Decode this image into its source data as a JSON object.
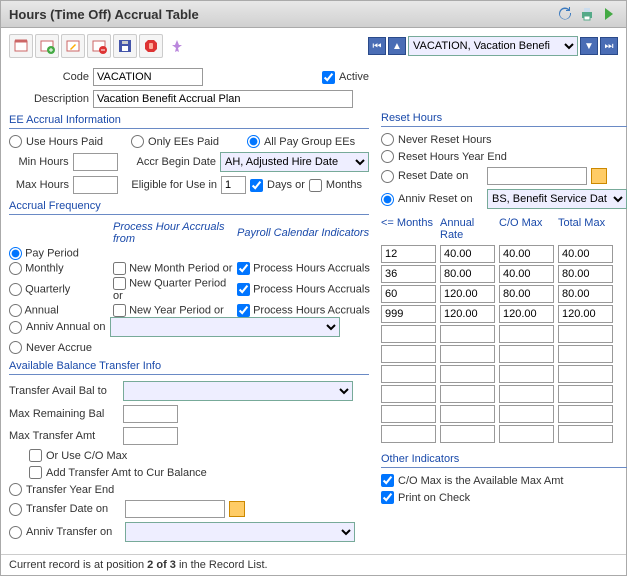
{
  "title": "Hours (Time Off) Accrual Table",
  "recordSelector": "VACATION, Vacation Benefi",
  "form": {
    "codeLabel": "Code",
    "code": "VACATION",
    "activeLabel": "Active",
    "descLabel": "Description",
    "desc": "Vacation Benefit Accrual Plan"
  },
  "eeAccrual": {
    "head": "EE Accrual Information",
    "useHoursPaid": "Use Hours Paid",
    "onlyEEsPaid": "Only EEs Paid",
    "allPayGroup": "All Pay Group EEs",
    "minHoursLabel": "Min Hours",
    "minHours": "",
    "accrBeginDateLabel": "Accr Begin Date",
    "accrBeginDate": "AH, Adjusted Hire Date",
    "maxHoursLabel": "Max Hours",
    "maxHours": "",
    "eligibleLabel": "Eligible for Use in",
    "eligible": "1",
    "daysLabel": "Days or",
    "monthsLabel": "Months"
  },
  "freq": {
    "head": "Accrual Frequency",
    "payPeriod": "Pay Period",
    "monthly": "Monthly",
    "quarterly": "Quarterly",
    "annual": "Annual",
    "annivAnnualOn": "Anniv Annual on",
    "neverAccrue": "Never Accrue",
    "procHead": "Process Hour Accruals from",
    "calHead": "Payroll Calendar Indicators",
    "newMonth": "New Month Period or",
    "newQuarter": "New Quarter Period or",
    "newYear": "New Year Period or",
    "procHours": "Process Hours Accruals"
  },
  "transfer": {
    "head": "Available Balance Transfer Info",
    "transferTo": "Transfer Avail Bal to",
    "maxRemain": "Max Remaining Bal",
    "maxTransfer": "Max Transfer Amt",
    "orUseCo": "Or Use C/O Max",
    "addToBal": "Add Transfer Amt to Cur Balance",
    "yearEnd": "Transfer Year End",
    "dateOn": "Transfer Date on",
    "annivOn": "Anniv Transfer on"
  },
  "reset": {
    "head": "Reset Hours",
    "never": "Never Reset Hours",
    "yearEnd": "Reset Hours Year End",
    "dateOn": "Reset Date on",
    "annivOn": "Anniv Reset on",
    "annivSel": "BS, Benefit Service Dat"
  },
  "tiers": {
    "hMonths": "<= Months",
    "hRate": "Annual Rate",
    "hCoMax": "C/O Max",
    "hTotal": "Total Max",
    "rows": [
      {
        "m": "12",
        "r": "40.00",
        "c": "40.00",
        "t": "40.00"
      },
      {
        "m": "36",
        "r": "80.00",
        "c": "40.00",
        "t": "80.00"
      },
      {
        "m": "60",
        "r": "120.00",
        "c": "80.00",
        "t": "80.00"
      },
      {
        "m": "999",
        "r": "120.00",
        "c": "120.00",
        "t": "120.00"
      },
      {
        "m": "",
        "r": "",
        "c": "",
        "t": ""
      },
      {
        "m": "",
        "r": "",
        "c": "",
        "t": ""
      },
      {
        "m": "",
        "r": "",
        "c": "",
        "t": ""
      },
      {
        "m": "",
        "r": "",
        "c": "",
        "t": ""
      },
      {
        "m": "",
        "r": "",
        "c": "",
        "t": ""
      },
      {
        "m": "",
        "r": "",
        "c": "",
        "t": ""
      }
    ]
  },
  "other": {
    "head": "Other Indicators",
    "coMaxAvail": "C/O Max is the Available Max Amt",
    "printCheck": "Print on Check"
  },
  "footer": {
    "pre": "Current record is at position ",
    "pos": "2 of 3",
    "post": " in the Record List."
  }
}
